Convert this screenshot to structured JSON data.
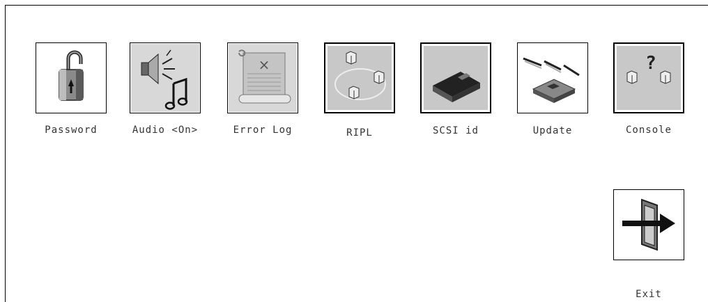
{
  "tools": [
    {
      "label": "Password",
      "icon": "padlock-icon"
    },
    {
      "label": "Audio <On>",
      "icon": "speaker-music-icon"
    },
    {
      "label": "Error Log",
      "icon": "scroll-icon"
    },
    {
      "label": "RIPL",
      "icon": "network-nodes-icon"
    },
    {
      "label": "SCSI id",
      "icon": "disk-drive-icon"
    },
    {
      "label": "Update",
      "icon": "flash-update-icon"
    },
    {
      "label": "Console",
      "icon": "console-question-icon"
    }
  ],
  "exit": {
    "label": "Exit",
    "icon": "exit-door-icon"
  }
}
